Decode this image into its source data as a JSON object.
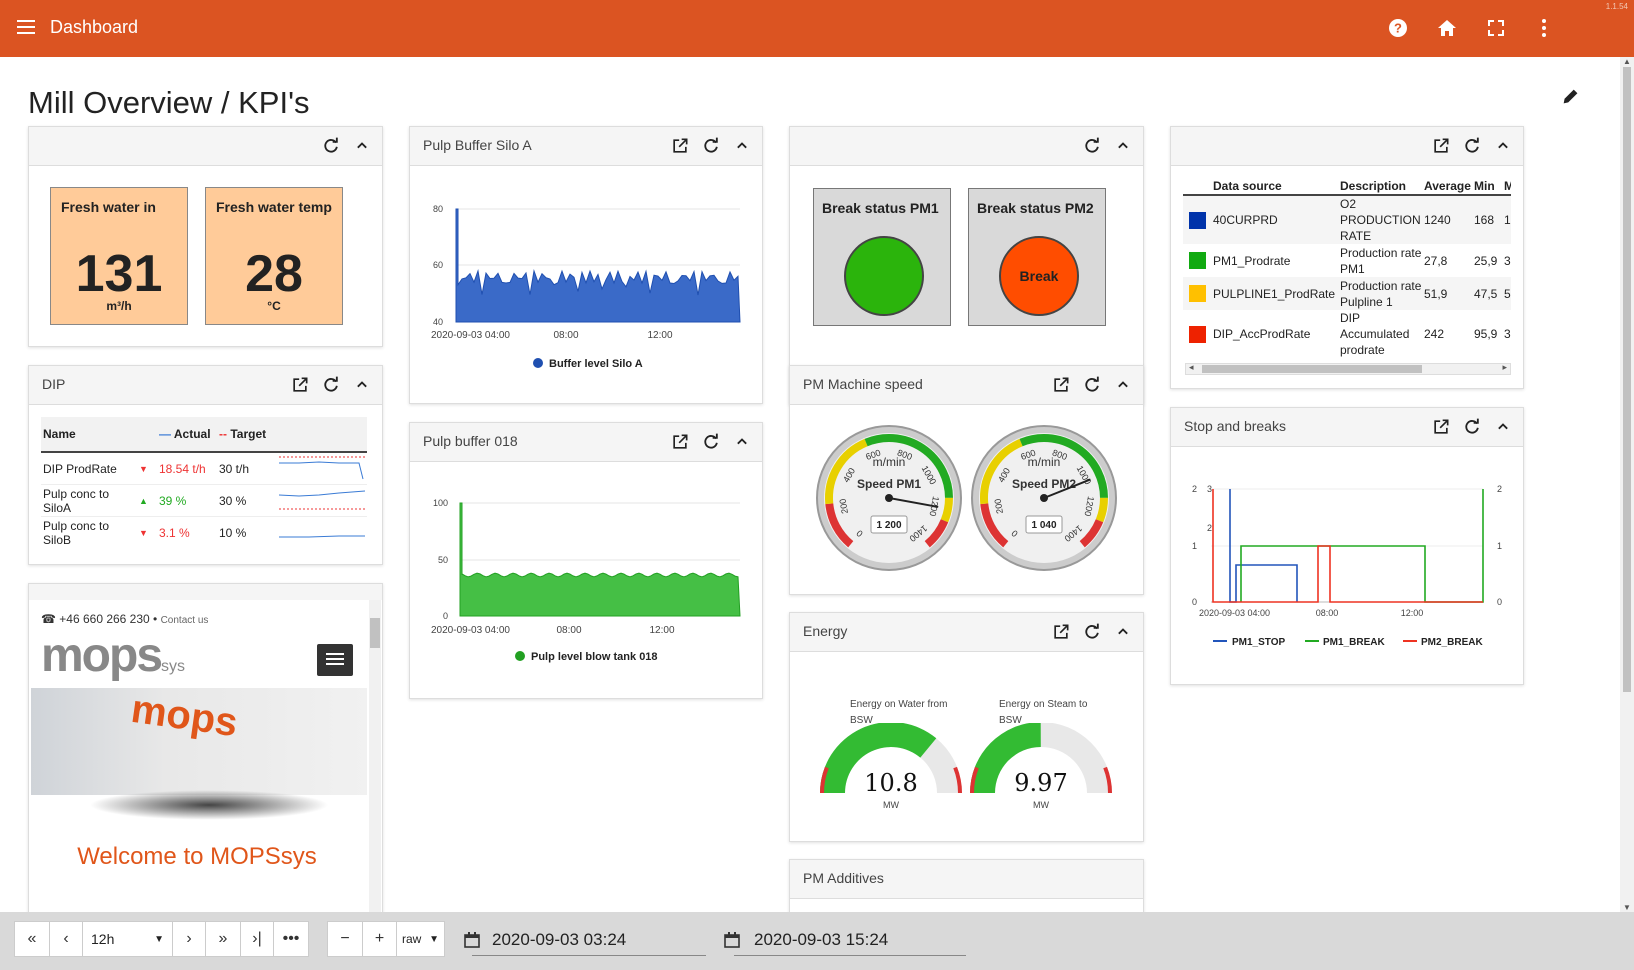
{
  "app": {
    "title": "Dashboard",
    "version": "1.1.54"
  },
  "page": {
    "title": "Mill Overview / KPI's"
  },
  "kpis": [
    {
      "label": "Fresh water in",
      "value": "131",
      "unit": "m³/h"
    },
    {
      "label": "Fresh water temp",
      "value": "28",
      "unit": "°C"
    }
  ],
  "breaks": [
    {
      "label": "Break status PM1",
      "state": "",
      "color": "#2bb40c"
    },
    {
      "label": "Break status PM2",
      "state": "Break",
      "color": "#ff4d00"
    }
  ],
  "dip": {
    "title": "DIP",
    "headers": {
      "name": "Name",
      "actual": "Actual",
      "target": "Target"
    },
    "rows": [
      {
        "name": "DIP ProdRate",
        "actual": "18.54 t/h",
        "target": "30 t/h",
        "trend": "down"
      },
      {
        "name": "Pulp conc to SiloA",
        "actual": "39 %",
        "target": "30 %",
        "trend": "up"
      },
      {
        "name": "Pulp conc to SiloB",
        "actual": "3.1 %",
        "target": "10 %",
        "trend": "down"
      }
    ]
  },
  "mops": {
    "phone": "+46 660 266 230",
    "contact": "Contact us",
    "logo_main": "mops",
    "logo_sub": "sys",
    "welcome": "Welcome to MOPSsys"
  },
  "silo_a": {
    "title": "Pulp Buffer Silo A",
    "legend": "Buffer level Silo A",
    "y_ticks": [
      "80",
      "60",
      "40"
    ],
    "x_ticks": [
      "2020-09-03 04:00",
      "08:00",
      "12:00"
    ]
  },
  "buffer018": {
    "title": "Pulp buffer 018",
    "legend": "Pulp level blow tank 018",
    "y_ticks": [
      "100",
      "50",
      "0"
    ],
    "x_ticks": [
      "2020-09-03 04:00",
      "08:00",
      "12:00"
    ]
  },
  "machine_speed": {
    "title": "PM Machine speed",
    "unit": "m/min",
    "gauges": [
      {
        "label": "Speed PM1",
        "value": "1 200"
      },
      {
        "label": "Speed PM2",
        "value": "1 040"
      }
    ],
    "scale": [
      "0",
      "200",
      "400",
      "600",
      "800",
      "1000",
      "1200",
      "1400"
    ]
  },
  "energy": {
    "title": "Energy",
    "gauges": [
      {
        "label": "Energy on Water from BSW",
        "value": "10.8",
        "unit": "MW",
        "min": "0",
        "max": "15"
      },
      {
        "label": "Energy on Steam to BSW",
        "value": "9.97",
        "unit": "MW",
        "min": "0",
        "max": "20"
      }
    ]
  },
  "additives": {
    "title": "PM Additives"
  },
  "datasources": {
    "headers": [
      "Data source",
      "Description",
      "Average",
      "Min",
      "M"
    ],
    "rows": [
      {
        "color": "#0033aa",
        "name": "40CURPRD",
        "desc": "O2 PRODUCTION RATE",
        "avg": "1240",
        "min": "168",
        "max": "1"
      },
      {
        "color": "#11aa11",
        "name": "PM1_Prodrate",
        "desc": "Production rate PM1",
        "avg": "27,8",
        "min": "25,9",
        "max": "3"
      },
      {
        "color": "#ffc000",
        "name": "PULPLINE1_ProdRate",
        "desc": "Production rate Pulpline 1",
        "avg": "51,9",
        "min": "47,5",
        "max": "5"
      },
      {
        "color": "#ee2200",
        "name": "DIP_AccProdRate",
        "desc": "DIP Accumulated prodrate",
        "avg": "242",
        "min": "95,9",
        "max": "3"
      }
    ]
  },
  "stops": {
    "title": "Stop and breaks",
    "legend": [
      "PM1_STOP",
      "PM1_BREAK",
      "PM2_BREAK"
    ],
    "y_left": [
      "2",
      "1",
      "0"
    ],
    "y_left2": [
      "3",
      "2"
    ],
    "y_right": [
      "2",
      "1",
      "0"
    ],
    "x_ticks": [
      "2020-09-03 04:00",
      "08:00",
      "12:00"
    ]
  },
  "bottom": {
    "range": "12h",
    "mode": "raw",
    "start": "2020-09-03 03:24",
    "end": "2020-09-03 15:24"
  }
}
